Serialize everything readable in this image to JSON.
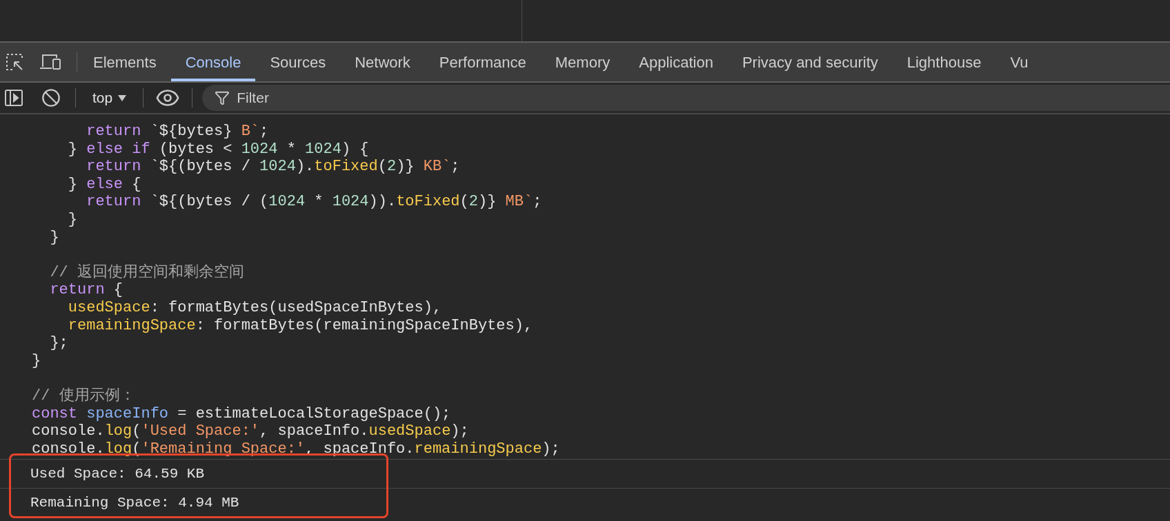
{
  "tabs": [
    {
      "label": "Elements",
      "selected": false
    },
    {
      "label": "Console",
      "selected": true
    },
    {
      "label": "Sources",
      "selected": false
    },
    {
      "label": "Network",
      "selected": false
    },
    {
      "label": "Performance",
      "selected": false
    },
    {
      "label": "Memory",
      "selected": false
    },
    {
      "label": "Application",
      "selected": false
    },
    {
      "label": "Privacy and security",
      "selected": false
    },
    {
      "label": "Lighthouse",
      "selected": false
    },
    {
      "label": "Vu",
      "selected": false
    }
  ],
  "toolbar": {
    "context": "top",
    "filter": {
      "placeholder": "Filter"
    }
  },
  "code_lines": [
    {
      "kind": "code",
      "tokens": [
        {
          "kind": "keyword",
          "text": "      return"
        },
        {
          "kind": "plain",
          "text": " `${bytes} "
        },
        {
          "kind": "string",
          "text": "B`"
        },
        {
          "kind": "plain",
          "text": ";"
        }
      ]
    },
    {
      "kind": "code",
      "tokens": [
        {
          "kind": "plain",
          "text": "    } "
        },
        {
          "kind": "keyword",
          "text": "else if"
        },
        {
          "kind": "plain",
          "text": " (bytes < "
        },
        {
          "kind": "number",
          "text": "1024"
        },
        {
          "kind": "plain",
          "text": " * "
        },
        {
          "kind": "number",
          "text": "1024"
        },
        {
          "kind": "plain",
          "text": ") {"
        }
      ]
    },
    {
      "kind": "code",
      "tokens": [
        {
          "kind": "keyword",
          "text": "      return"
        },
        {
          "kind": "plain",
          "text": " `${(bytes / "
        },
        {
          "kind": "number",
          "text": "1024"
        },
        {
          "kind": "plain",
          "text": ")."
        },
        {
          "kind": "property",
          "text": "toFixed"
        },
        {
          "kind": "plain",
          "text": "("
        },
        {
          "kind": "number",
          "text": "2"
        },
        {
          "kind": "plain",
          "text": ")} "
        },
        {
          "kind": "string",
          "text": "KB`"
        },
        {
          "kind": "plain",
          "text": ";"
        }
      ]
    },
    {
      "kind": "code",
      "tokens": [
        {
          "kind": "plain",
          "text": "    } "
        },
        {
          "kind": "keyword",
          "text": "else"
        },
        {
          "kind": "plain",
          "text": " {"
        }
      ]
    },
    {
      "kind": "code",
      "tokens": [
        {
          "kind": "keyword",
          "text": "      return"
        },
        {
          "kind": "plain",
          "text": " `${(bytes / ("
        },
        {
          "kind": "number",
          "text": "1024"
        },
        {
          "kind": "plain",
          "text": " * "
        },
        {
          "kind": "number",
          "text": "1024"
        },
        {
          "kind": "plain",
          "text": "))."
        },
        {
          "kind": "property",
          "text": "toFixed"
        },
        {
          "kind": "plain",
          "text": "("
        },
        {
          "kind": "number",
          "text": "2"
        },
        {
          "kind": "plain",
          "text": ")} "
        },
        {
          "kind": "string",
          "text": "MB`"
        },
        {
          "kind": "plain",
          "text": ";"
        }
      ]
    },
    {
      "kind": "code",
      "tokens": [
        {
          "kind": "plain",
          "text": "    }"
        }
      ]
    },
    {
      "kind": "code",
      "tokens": [
        {
          "kind": "plain",
          "text": "  }"
        }
      ]
    },
    {
      "kind": "blank"
    },
    {
      "kind": "code",
      "tokens": [
        {
          "kind": "comment",
          "text": "  // 返回使用空间和剩余空间"
        }
      ]
    },
    {
      "kind": "code",
      "tokens": [
        {
          "kind": "keyword",
          "text": "  return"
        },
        {
          "kind": "plain",
          "text": " {"
        }
      ]
    },
    {
      "kind": "code",
      "tokens": [
        {
          "kind": "property",
          "text": "    usedSpace"
        },
        {
          "kind": "plain",
          "text": ": formatBytes(usedSpaceInBytes),"
        }
      ]
    },
    {
      "kind": "code",
      "tokens": [
        {
          "kind": "property",
          "text": "    remainingSpace"
        },
        {
          "kind": "plain",
          "text": ": formatBytes(remainingSpaceInBytes),"
        }
      ]
    },
    {
      "kind": "code",
      "tokens": [
        {
          "kind": "plain",
          "text": "  };"
        }
      ]
    },
    {
      "kind": "code",
      "tokens": [
        {
          "kind": "plain",
          "text": "}"
        }
      ]
    },
    {
      "kind": "blank"
    },
    {
      "kind": "code",
      "tokens": [
        {
          "kind": "comment",
          "text": "// 使用示例："
        }
      ]
    },
    {
      "kind": "code",
      "tokens": [
        {
          "kind": "keyword",
          "text": "const "
        },
        {
          "kind": "variable",
          "text": "spaceInfo"
        },
        {
          "kind": "plain",
          "text": " = estimateLocalStorageSpace();"
        }
      ]
    },
    {
      "kind": "code",
      "tokens": [
        {
          "kind": "plain",
          "text": "console."
        },
        {
          "kind": "property",
          "text": "log"
        },
        {
          "kind": "plain",
          "text": "("
        },
        {
          "kind": "string",
          "text": "'Used Space:'"
        },
        {
          "kind": "plain",
          "text": ", spaceInfo."
        },
        {
          "kind": "property",
          "text": "usedSpace"
        },
        {
          "kind": "plain",
          "text": ");"
        }
      ]
    },
    {
      "kind": "code",
      "tokens": [
        {
          "kind": "plain",
          "text": "console."
        },
        {
          "kind": "property",
          "text": "log"
        },
        {
          "kind": "plain",
          "text": "("
        },
        {
          "kind": "string",
          "text": "'Remaining Space:'"
        },
        {
          "kind": "plain",
          "text": ", spaceInfo."
        },
        {
          "kind": "property",
          "text": "remainingSpace"
        },
        {
          "kind": "plain",
          "text": ");"
        }
      ]
    }
  ],
  "console_output": [
    {
      "text": "Used Space: 64.59 KB"
    },
    {
      "text": "Remaining Space: 4.94 MB"
    }
  ]
}
